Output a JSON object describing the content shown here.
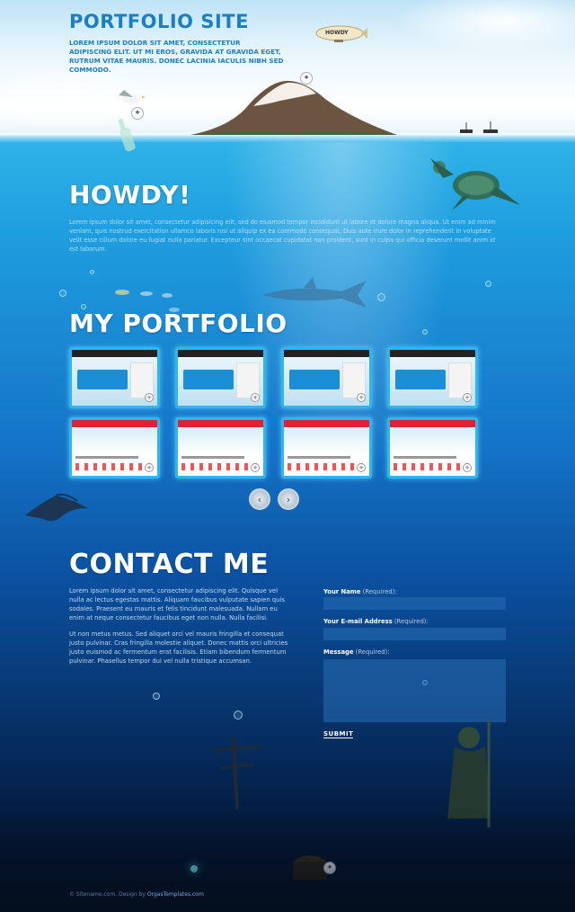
{
  "header": {
    "site_title": "PORTFOLIO SITE",
    "tagline": "LOREM IPSUM DOLOR SIT AMET, CONSECTETUR ADIPISCING ELIT. UT MI EROS, GRAVIDA AT GRAVIDA EGET, RUTRUM VITAE MAURIS. DONEC LACINIA IACULIS NIBH SED COMMODO.",
    "blimp_label": "HOWDY"
  },
  "howdy": {
    "title": "HOWDY!",
    "text": "Lorem ipsum dolor sit amet, consectetur adipisicing elit, sed do eiusmod tempor incididunt ut labore et dolore magna aliqua. Ut enim ad minim veniam, quis nostrud exercitation ullamco laboris nisi ut aliquip ex ea commodo consequat. Duis aute irure dolor in reprehenderit in voluptate velit esse cillum dolore eu fugiat nulla pariatur. Excepteur sint occaecat cupidatat non proident, sunt in culpa qui officia deserunt mollit anim id est laborum."
  },
  "portfolio": {
    "title": "MY PORTFOLIO",
    "prev_icon": "chevron-left-icon",
    "next_icon": "chevron-right-icon",
    "prev_glyph": "‹",
    "next_glyph": "›"
  },
  "contact": {
    "title": "CONTACT ME",
    "paragraph1": "Lorem ipsum dolor sit amet, consectetur adipiscing elit. Quisque vel nulla ac lectus egestas mattis. Aliquam faucibus vulputate sapien quis sodales. Praesent eu mauris et felis tincidunt malesuada. Nullam eu enim at neque consectetur faucibus eget non nulla. Nulla facilisi.",
    "paragraph2": "Ut non metus metus. Sed aliquet orci vel mauris fringilla et consequat justo pulvinar. Cras fringilla molestie aliquet. Donec mattis orci ultricies justo euismod ac fermentum erat facilisis. Etiam bibendum fermentum pulvinar. Phasellus tempor dui vel nulla tristique accumsan.",
    "name_label": "Your Name",
    "email_label": "Your E-mail Address",
    "message_label": "Message",
    "required": "(Required):",
    "submit": "SUBMIT"
  },
  "footer": {
    "copyright": "© Sitename.com.",
    "design_by": "Design by",
    "link": "OrgasTemplates.com"
  },
  "colors": {
    "title_blue": "#1b7fc6",
    "thumb_border": "#2fb6f0",
    "deep_ocean": "#020d22"
  }
}
